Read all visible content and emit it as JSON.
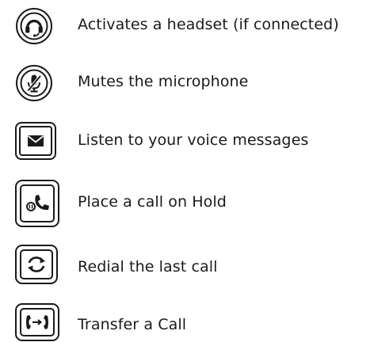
{
  "items": [
    {
      "icon": "headset-icon",
      "label": "Activates a headset (if connected)"
    },
    {
      "icon": "mute-microphone-icon",
      "label": "Mutes the microphone"
    },
    {
      "icon": "voicemail-envelope-icon",
      "label": "Listen to your voice messages"
    },
    {
      "icon": "hold-icon",
      "label": "Place a call on Hold"
    },
    {
      "icon": "redial-icon",
      "label": "Redial the last call"
    },
    {
      "icon": "transfer-icon",
      "label": "Transfer a Call"
    }
  ]
}
